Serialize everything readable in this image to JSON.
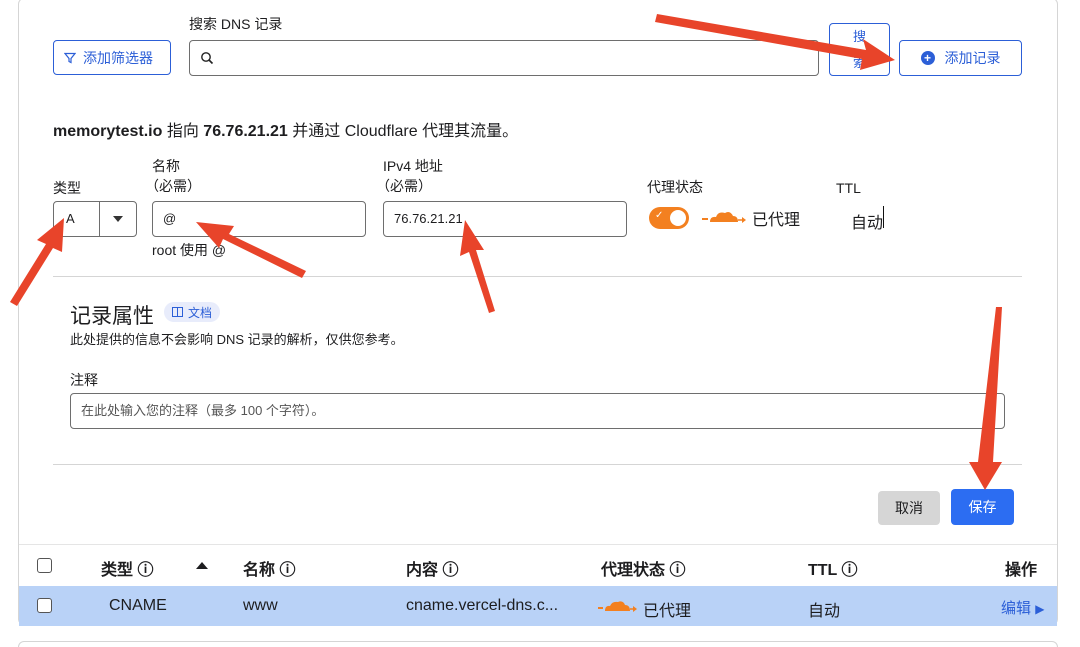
{
  "toolbar": {
    "search_label": "搜索 DNS 记录",
    "filter_label": "添加筛选器",
    "search_placeholder": "",
    "search_button": "搜索",
    "add_record_label": "添加记录"
  },
  "info": {
    "domain": "memorytest.io",
    "points_to": "指向",
    "ip": "76.76.21.21",
    "rest": "并通过 Cloudflare 代理其流量。"
  },
  "form": {
    "type_label": "类型",
    "type_value": "A",
    "name_label": "名称",
    "name_required": "（必需）",
    "name_value": "@",
    "name_hint": "root 使用 @",
    "ip_label": "IPv4 地址",
    "ip_required": "（必需）",
    "ip_value": "76.76.21.21",
    "proxy_label": "代理状态",
    "proxy_status": "已代理",
    "ttl_label": "TTL",
    "ttl_value": "自动"
  },
  "attributes": {
    "title": "记录属性",
    "doc_badge": "文档",
    "description": "此处提供的信息不会影响 DNS 记录的解析，仅供您参考。",
    "note_label": "注释",
    "note_placeholder": "在此处输入您的注释（最多 100 个字符）。"
  },
  "actions": {
    "cancel": "取消",
    "save": "保存"
  },
  "table": {
    "headers": {
      "type": "类型 ⓘ",
      "name": "名称 ⓘ",
      "content": "内容 ⓘ",
      "proxy": "代理状态 ⓘ",
      "ttl": "TTL ⓘ",
      "actions": "操作"
    },
    "rows": [
      {
        "type": "CNAME",
        "name": "www",
        "content": "cname.vercel-dns.c...",
        "proxy": "已代理",
        "ttl": "自动",
        "action": "编辑"
      }
    ]
  },
  "colors": {
    "accent": "#2c5fd7",
    "save": "#2c6df2",
    "proxy_orange": "#f38020",
    "row_highlight": "#b9d2f7",
    "annotation_arrow": "#e8442a"
  }
}
